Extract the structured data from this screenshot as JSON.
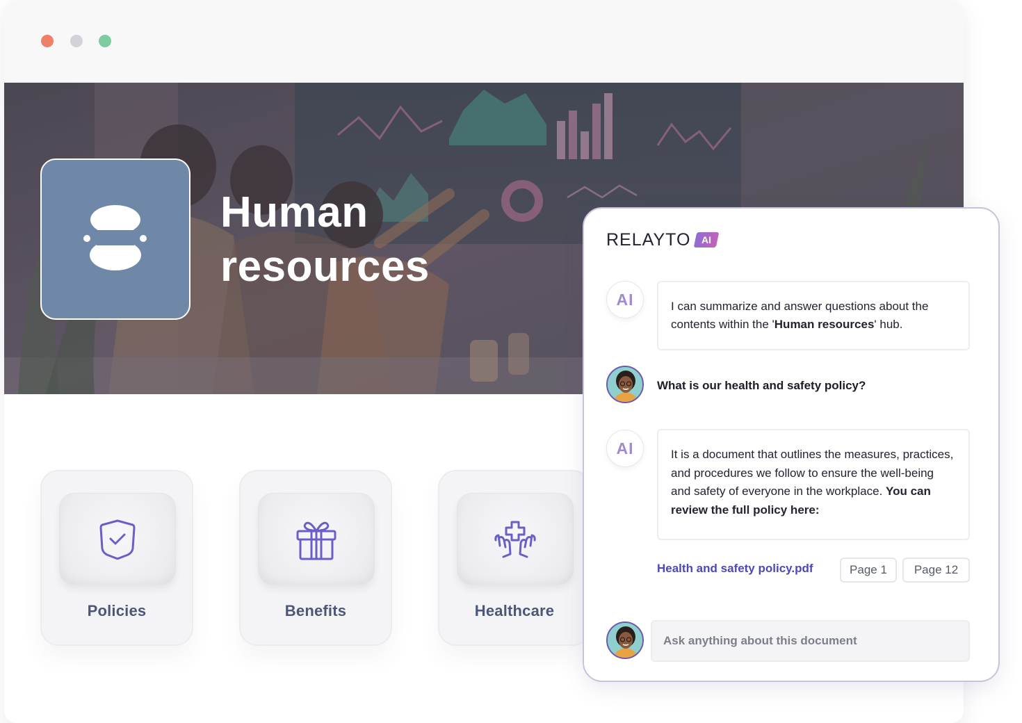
{
  "window": {
    "controls": [
      "close",
      "minimize",
      "maximize"
    ]
  },
  "hub": {
    "title_line1": "Human",
    "title_line2": "resources",
    "logo_icon": "stacked-ovals-icon"
  },
  "categories": [
    {
      "label": "Policies",
      "icon": "shield-check-icon"
    },
    {
      "label": "Benefits",
      "icon": "gift-icon"
    },
    {
      "label": "Healthcare",
      "icon": "hands-medical-cross-icon"
    }
  ],
  "chat": {
    "brand": "RELAYTO",
    "brand_badge": "AI",
    "ai_avatar": "AI",
    "intro_prefix": "I can summarize and answer questions about the contents within the '",
    "intro_bold": "Human resources",
    "intro_suffix": "' hub.",
    "user_question": "What is our health and safety policy?",
    "answer_text": "It is a document that outlines the measures, practices, and procedures we follow to ensure the well-being and safety of everyone in the workplace.",
    "answer_bold": "You can review the full policy here:",
    "source_file": "Health and safety policy.pdf",
    "page_refs": [
      "Page 1",
      "Page 12"
    ],
    "input_placeholder": "Ask anything about this document"
  },
  "colors": {
    "accent": "#4b48b8",
    "icon_purple": "#6a5fc6",
    "hub_logo_bg": "#7088a8",
    "chat_border": "#c9c2dc"
  }
}
